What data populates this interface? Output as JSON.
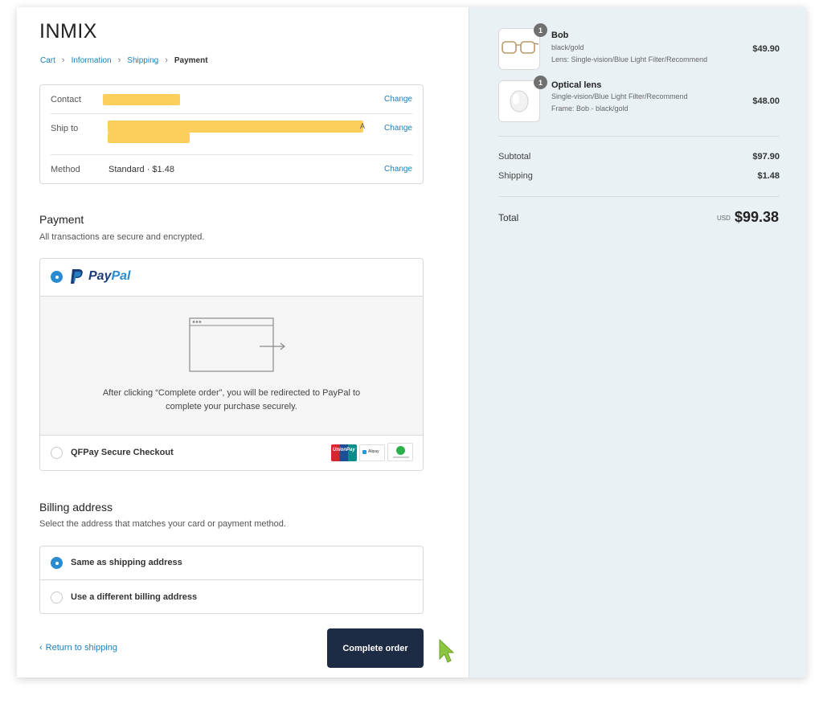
{
  "store": {
    "name": "INMIX"
  },
  "breadcrumb": {
    "cart": "Cart",
    "information": "Information",
    "shipping": "Shipping",
    "payment": "Payment"
  },
  "review": {
    "contact_label": "Contact",
    "ship_to_label": "Ship to",
    "ship_to_trailing": "A",
    "method_label": "Method",
    "method_value": "Standard · $1.48",
    "change_label": "Change"
  },
  "payment": {
    "title": "Payment",
    "subtitle": "All transactions are secure and encrypted.",
    "paypal_brand": "PayPal",
    "redirect_line1": "After clicking “Complete order”, you will be redirected to PayPal to",
    "redirect_line2": "complete your purchase securely.",
    "qfpay_label": "QFPay Secure Checkout",
    "unionpay_label": "UnionPay",
    "alipay_label": "Alipay",
    "selected": "PayPal"
  },
  "billing": {
    "title": "Billing address",
    "subtitle": "Select the address that matches your card or payment method.",
    "option_same": "Same as shipping address",
    "option_different": "Use a different billing address",
    "selected": "Same as shipping address"
  },
  "actions": {
    "return_label": "Return to shipping",
    "complete_label": "Complete order"
  },
  "order": {
    "items": [
      {
        "name": "Bob",
        "qty": "1",
        "lines": [
          "black/gold",
          "Lens: Single-vision/Blue Light Filter/Recommend"
        ],
        "price": "$49.90",
        "icon": "glasses-icon"
      },
      {
        "name": "Optical lens",
        "qty": "1",
        "lines": [
          "Single-vision/Blue Light Filter/Recommend",
          "Frame: Bob - black/gold"
        ],
        "price": "$48.00",
        "icon": "lens-icon"
      }
    ],
    "subtotal_label": "Subtotal",
    "subtotal_value": "$97.90",
    "shipping_label": "Shipping",
    "shipping_value": "$1.48",
    "total_label": "Total",
    "currency": "USD",
    "total_value": "$99.38"
  },
  "colors": {
    "accent": "#2a8bd0",
    "link": "#1b7fb8",
    "button": "#1e2b45",
    "summary_bg": "#e9f1f5",
    "redaction": "#fcc94a",
    "cursor": "#8cc63f"
  }
}
